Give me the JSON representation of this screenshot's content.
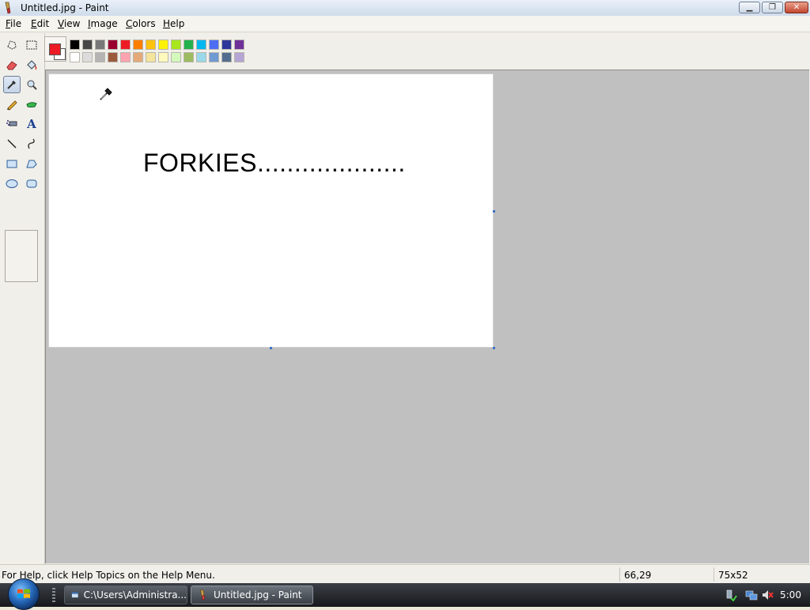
{
  "window": {
    "title": "Untitled.jpg - Paint",
    "controls": {
      "minimize": "▁",
      "maximize": "❐",
      "close": "✕"
    }
  },
  "menu": [
    {
      "label": "File",
      "accel": "F",
      "rest": "ile"
    },
    {
      "label": "Edit",
      "accel": "E",
      "rest": "dit"
    },
    {
      "label": "View",
      "accel": "V",
      "rest": "iew"
    },
    {
      "label": "Image",
      "accel": "I",
      "rest": "mage"
    },
    {
      "label": "Colors",
      "accel": "C",
      "rest": "olors"
    },
    {
      "label": "Help",
      "accel": "H",
      "rest": "elp"
    }
  ],
  "tools": [
    {
      "name": "free-form-select-icon",
      "selected": false
    },
    {
      "name": "rect-select-icon",
      "selected": false
    },
    {
      "name": "eraser-icon",
      "selected": false
    },
    {
      "name": "fill-bucket-icon",
      "selected": false
    },
    {
      "name": "color-picker-icon",
      "selected": true
    },
    {
      "name": "magnifier-icon",
      "selected": false
    },
    {
      "name": "pencil-icon",
      "selected": false
    },
    {
      "name": "brush-icon",
      "selected": false
    },
    {
      "name": "airbrush-icon",
      "selected": false
    },
    {
      "name": "text-icon",
      "selected": false
    },
    {
      "name": "line-icon",
      "selected": false
    },
    {
      "name": "curve-icon",
      "selected": false
    },
    {
      "name": "rectangle-icon",
      "selected": false
    },
    {
      "name": "polygon-icon",
      "selected": false
    },
    {
      "name": "ellipse-icon",
      "selected": false
    },
    {
      "name": "rounded-rectangle-icon",
      "selected": false
    }
  ],
  "text_tool_glyph": "A",
  "colors": {
    "foreground": "#ed1c24",
    "background": "#ffffff",
    "palette_top": [
      "#000000",
      "#464646",
      "#787878",
      "#990030",
      "#ed1c24",
      "#ff7e00",
      "#ffc20e",
      "#fff200",
      "#a8e61d",
      "#22b14c",
      "#00b7ef",
      "#4d6df3",
      "#2f3699",
      "#6f3198"
    ],
    "palette_bottom": [
      "#ffffff",
      "#dcdcdc",
      "#b4b4b4",
      "#9c5a3c",
      "#ffa3b1",
      "#e5aa7a",
      "#f5e49c",
      "#fff9bd",
      "#d3f9bc",
      "#9dbb61",
      "#99d9ea",
      "#709ad1",
      "#546d8e",
      "#b5a5d5"
    ]
  },
  "canvas": {
    "text": "FORKIES...................."
  },
  "status": {
    "help": "For Help, click Help Topics on the Help Menu.",
    "coords": "66,29",
    "size": "75x52"
  },
  "taskbar": {
    "items": [
      {
        "label": "C:\\Users\\Administra...",
        "active": false
      },
      {
        "label": "Untitled.jpg - Paint",
        "active": true
      }
    ],
    "clock": "5:00"
  }
}
